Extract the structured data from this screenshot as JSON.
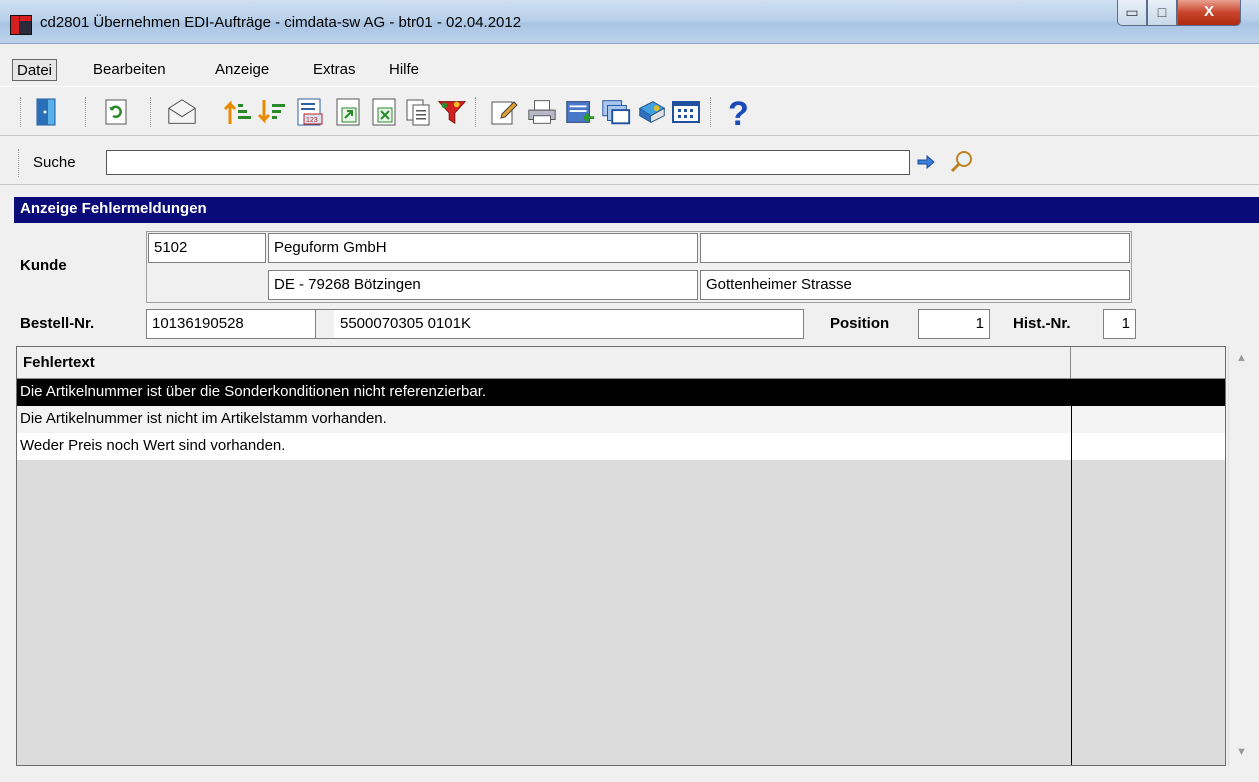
{
  "window": {
    "title": "cd2801 Übernehmen EDI-Aufträge - cimdata-sw AG - btr01 - 02.04.2012",
    "min_glyph": "▭",
    "max_glyph": "□",
    "close_glyph": "X"
  },
  "menu": {
    "items": [
      {
        "label": "Datei"
      },
      {
        "label": "Bearbeiten"
      },
      {
        "label": "Anzeige"
      },
      {
        "label": "Extras"
      },
      {
        "label": "Hilfe"
      }
    ]
  },
  "toolbar": {
    "icons": [
      "exit-icon",
      "refresh-icon",
      "mail-icon",
      "sort-ascending-icon",
      "sort-descending-icon",
      "number-list-icon",
      "export-icon",
      "excel-icon",
      "copy-icon",
      "filter-icon",
      "edit-icon",
      "print-icon",
      "import-icon",
      "windows-icon",
      "book-icon",
      "columns-icon",
      "help-icon"
    ]
  },
  "search": {
    "label": "Suche",
    "value": ""
  },
  "section": {
    "title": "Anzeige Fehlermeldungen"
  },
  "customer": {
    "label": "Kunde",
    "number": "5102",
    "name": "Peguform GmbH",
    "extra": "",
    "city": "DE - 79268 Bötzingen",
    "street": "Gottenheimer Strasse"
  },
  "order": {
    "label": "Bestell-Nr.",
    "number": "10136190528",
    "reference": "5500070305  0101K",
    "position_label": "Position",
    "position": "1",
    "hist_label": "Hist.-Nr.",
    "hist": "1"
  },
  "grid": {
    "header": "Fehlertext",
    "rows": [
      {
        "text": "Die Artikelnummer ist über die Sonderkonditionen nicht referenzierbar."
      },
      {
        "text": "Die Artikelnummer ist nicht im Artikelstamm vorhanden."
      },
      {
        "text": "Weder Preis noch Wert sind vorhanden."
      }
    ]
  },
  "colors": {
    "section_header": "#0a0a78",
    "selected_row": "#000000"
  }
}
